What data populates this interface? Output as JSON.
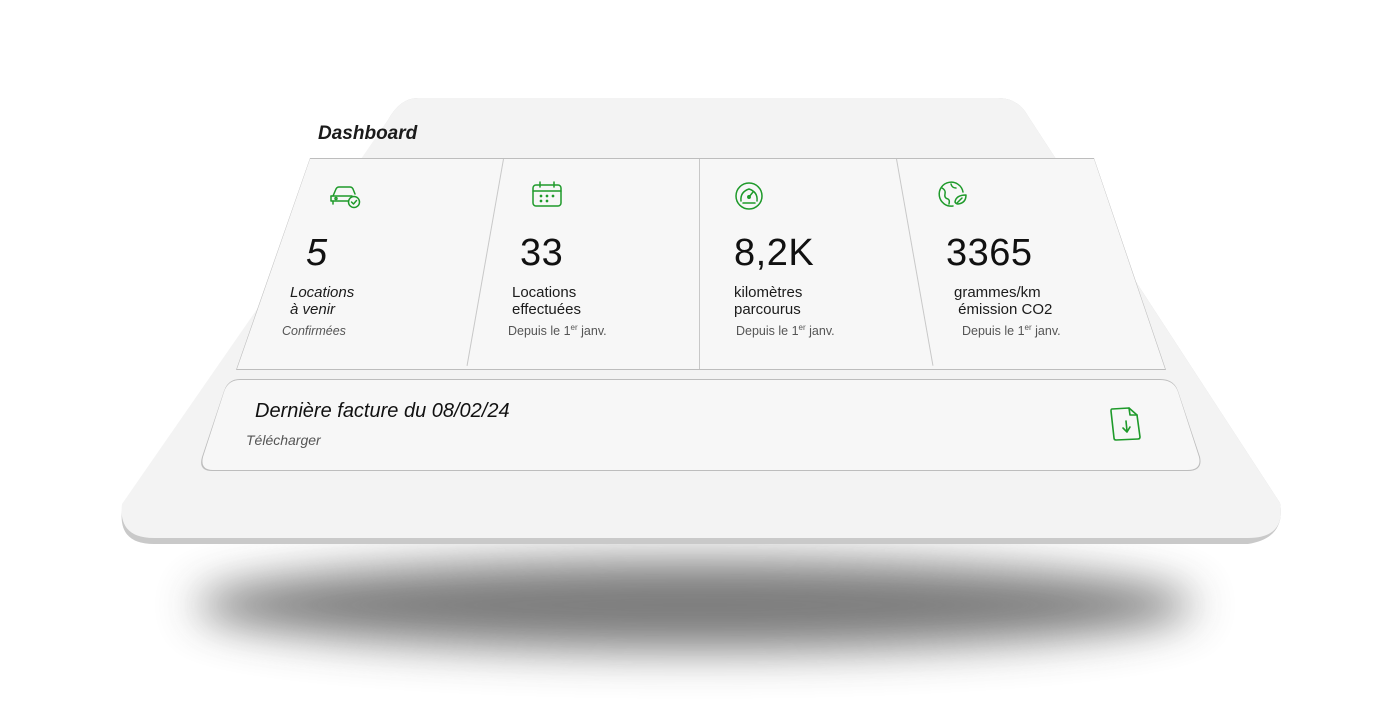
{
  "dashboard": {
    "title": "Dashboard"
  },
  "accent_color": "#1e9a2a",
  "stats": [
    {
      "icon": "car-check-icon",
      "value": "5",
      "label": "Locations\nà venir",
      "sub": "Confirmées"
    },
    {
      "icon": "calendar-icon",
      "value": "33",
      "label": "Locations\neffectuées",
      "sub_prefix": "Depuis le 1",
      "sub_sup": "er",
      "sub_suffix": " janv."
    },
    {
      "icon": "speedometer-icon",
      "value": "8,2K",
      "label": "kilomètres\nparcourus",
      "sub_prefix": "Depuis le 1",
      "sub_sup": "er",
      "sub_suffix": " janv."
    },
    {
      "icon": "eco-globe-leaf-icon",
      "value": "3365",
      "label": "grammes/km\n émission CO2",
      "sub_prefix": "Depuis le 1",
      "sub_sup": "er",
      "sub_suffix": " janv."
    }
  ],
  "invoice": {
    "title": "Dernière facture du 08/02/24",
    "link": "Télécharger",
    "icon": "file-download-icon"
  }
}
